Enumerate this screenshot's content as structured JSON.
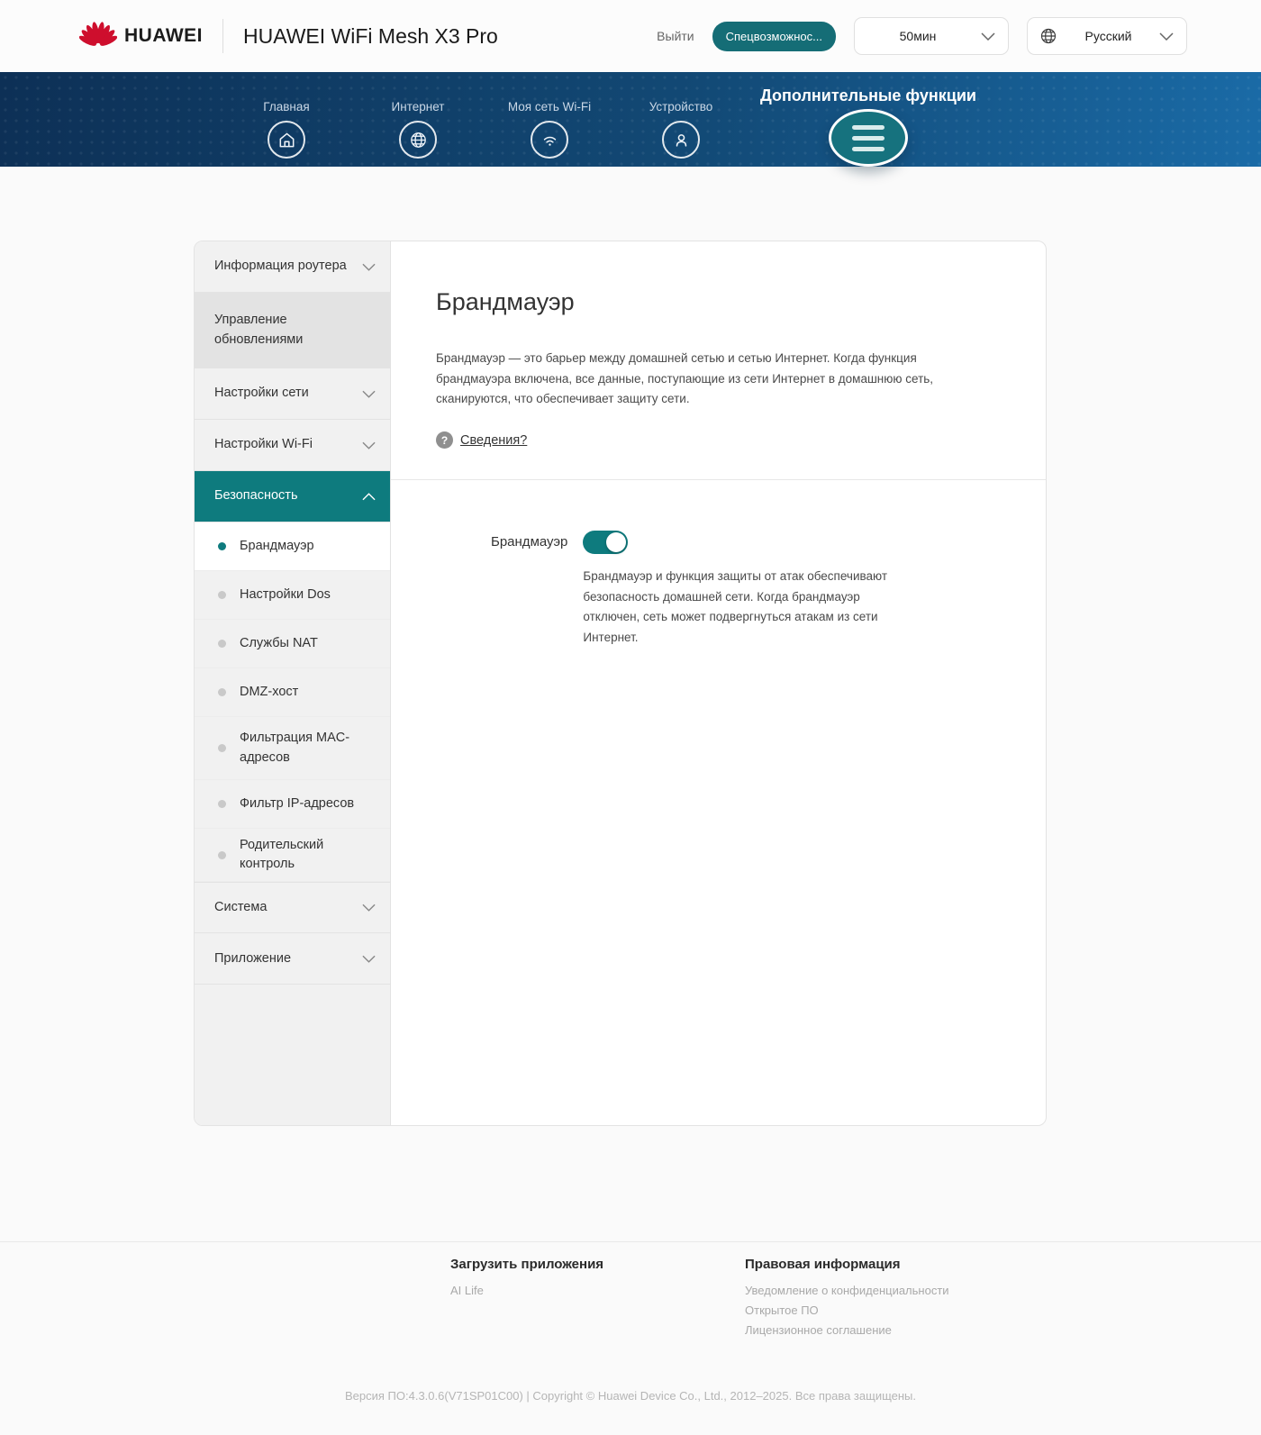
{
  "header": {
    "brand": "HUAWEI",
    "product_title": "HUAWEI WiFi Mesh X3 Pro",
    "logout_label": "Выйти",
    "accessibility_label": "Спецвозможнос...",
    "session_timeout_value": "50мин",
    "language_value": "Русский"
  },
  "nav": {
    "items": [
      {
        "label": "Главная",
        "icon": "home-icon",
        "active": false
      },
      {
        "label": "Интернет",
        "icon": "globe-icon",
        "active": false
      },
      {
        "label": "Моя сеть Wi-Fi",
        "icon": "wifi-icon",
        "active": false
      },
      {
        "label": "Устройство",
        "icon": "device-user-icon",
        "active": false
      },
      {
        "label": "Дополнительные функции",
        "icon": "hamburger-menu-icon",
        "active": true
      }
    ]
  },
  "sidebar": {
    "items_top": [
      {
        "label": "Информация роутера",
        "expandable": true
      },
      {
        "label": "Управление обновлениями",
        "expandable": false
      },
      {
        "label": "Настройки сети",
        "expandable": true
      },
      {
        "label": "Настройки Wi-Fi",
        "expandable": true
      },
      {
        "label": "Безопасность",
        "expandable": true,
        "expanded": true,
        "active": true
      }
    ],
    "security_subitems": [
      {
        "label": "Брандмауэр",
        "active": true
      },
      {
        "label": "Настройки Dos",
        "active": false
      },
      {
        "label": "Службы NAT",
        "active": false
      },
      {
        "label": "DMZ-хост",
        "active": false
      },
      {
        "label": "Фильтрация MAC-адресов",
        "active": false
      },
      {
        "label": "Фильтр IP-адресов",
        "active": false
      },
      {
        "label": "Родительский контроль",
        "active": false
      }
    ],
    "items_bottom": [
      {
        "label": "Система",
        "expandable": true
      },
      {
        "label": "Приложение",
        "expandable": true
      }
    ]
  },
  "main": {
    "title": "Брандмауэр",
    "description": "Брандмауэр — это барьер между домашней сетью и сетью Интернет. Когда функция брандмауэра включена, все данные, поступающие из сети Интернет в домашнюю сеть, сканируются, что обеспечивает защиту сети.",
    "question_glyph": "?",
    "details_link": "Сведения?",
    "firewall_toggle": {
      "label": "Брандмауэр",
      "state": "on",
      "note": "Брандмауэр и функция защиты от атак обеспечивают безопасность домашней сети. Когда брандмауэр отключен, сеть может подвергнуться атакам из сети Интернет."
    }
  },
  "footer": {
    "apps": {
      "title": "Загрузить приложения",
      "links": [
        "AI Life"
      ]
    },
    "legal": {
      "title": "Правовая информация",
      "links": [
        "Уведомление о конфиденциальности",
        "Открытое ПО",
        "Лицензионное соглашение"
      ]
    },
    "copyright": "Версия ПО:4.3.0.6(V71SP01C00) | Copyright © Huawei Device Co., Ltd., 2012–2025. Все права защищены."
  },
  "colors": {
    "accent_teal": "#0e7b7e",
    "button_teal": "#156d76",
    "menu_circle_teal": "#16727e",
    "brand_red": "#ce0e2d",
    "navbar_gradient_start": "#0d3056",
    "navbar_gradient_end": "#1a6ba7"
  }
}
